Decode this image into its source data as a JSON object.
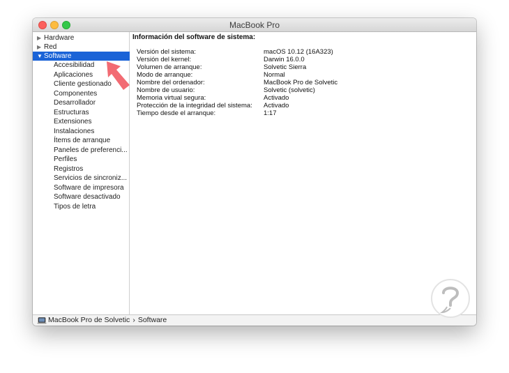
{
  "window": {
    "title": "MacBook Pro"
  },
  "sidebar": {
    "items": [
      {
        "label": "Hardware",
        "level": "top",
        "expanded": false,
        "selected": false
      },
      {
        "label": "Red",
        "level": "top",
        "expanded": false,
        "selected": false
      },
      {
        "label": "Software",
        "level": "top",
        "expanded": true,
        "selected": true
      },
      {
        "label": "Accesibilidad",
        "level": "child",
        "selected": false
      },
      {
        "label": "Aplicaciones",
        "level": "child",
        "selected": false
      },
      {
        "label": "Cliente gestionado",
        "level": "child",
        "selected": false
      },
      {
        "label": "Componentes",
        "level": "child",
        "selected": false
      },
      {
        "label": "Desarrollador",
        "level": "child",
        "selected": false
      },
      {
        "label": "Estructuras",
        "level": "child",
        "selected": false
      },
      {
        "label": "Extensiones",
        "level": "child",
        "selected": false
      },
      {
        "label": "Instalaciones",
        "level": "child",
        "selected": false
      },
      {
        "label": "Ítems de arranque",
        "level": "child",
        "selected": false
      },
      {
        "label": "Paneles de preferenci...",
        "level": "child",
        "selected": false
      },
      {
        "label": "Perfiles",
        "level": "child",
        "selected": false
      },
      {
        "label": "Registros",
        "level": "child",
        "selected": false
      },
      {
        "label": "Servicios de sincroniz...",
        "level": "child",
        "selected": false
      },
      {
        "label": "Software de impresora",
        "level": "child",
        "selected": false
      },
      {
        "label": "Software desactivado",
        "level": "child",
        "selected": false
      },
      {
        "label": "Tipos de letra",
        "level": "child",
        "selected": false
      }
    ]
  },
  "content": {
    "heading": "Información del software de sistema:",
    "rows": [
      {
        "key": "Versión del sistema:",
        "value": "macOS 10.12 (16A323)"
      },
      {
        "key": "Versión del kernel:",
        "value": "Darwin 16.0.0"
      },
      {
        "key": "Volumen de arranque:",
        "value": "Solvetic Sierra"
      },
      {
        "key": "Modo de arranque:",
        "value": "Normal"
      },
      {
        "key": "Nombre del ordenador:",
        "value": "MacBook Pro de Solvetic"
      },
      {
        "key": "Nombre de usuario:",
        "value": "Solvetic (solvetic)"
      },
      {
        "key": "Memoria virtual segura:",
        "value": "Activado"
      },
      {
        "key": "Protección de la integridad del sistema:",
        "value": "Activado"
      },
      {
        "key": "Tiempo desde el arranque:",
        "value": "1:17"
      }
    ]
  },
  "statusbar": {
    "device": "MacBook Pro de Solvetic",
    "separator": "›",
    "section": "Software",
    "icon": "laptop-icon"
  },
  "colors": {
    "selection": "#1a63d7",
    "annotation_arrow": "#f26b73",
    "close": "#fc605c",
    "minimize": "#fdbc40",
    "maximize": "#34c84a"
  }
}
